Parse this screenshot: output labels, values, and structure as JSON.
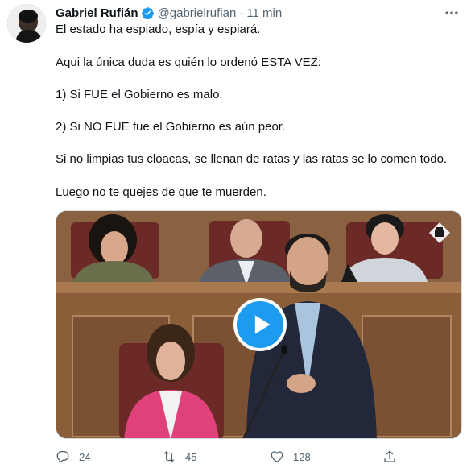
{
  "tweet": {
    "author_name": "Gabriel Rufián",
    "handle": "@gabrielrufian",
    "separator": "·",
    "time": "11 min",
    "verified": true,
    "paragraphs": [
      "El estado ha espiado, espía y espiará.",
      "Aqui la única duda es quién lo ordenó ESTA VEZ:",
      "1) Si FUE el Gobierno es malo.",
      "2) Si NO FUE fue el Gobierno es aún peor.",
      "Si no limpias tus cloacas, se llenan de ratas y las ratas se lo comen todo.",
      "Luego no te quejes de que te muerden."
    ],
    "media": {
      "type": "video",
      "play_icon": "play-icon",
      "watermark_icon": "congress-logo-icon"
    },
    "actions": {
      "reply_count": "24",
      "retweet_count": "45",
      "like_count": "128"
    }
  },
  "icons": {
    "more": "more-options-icon",
    "reply": "reply-icon",
    "retweet": "retweet-icon",
    "like": "heart-icon",
    "share": "share-icon",
    "verified": "verified-badge-icon"
  },
  "colors": {
    "accent": "#1d9bf0",
    "text_primary": "#0f1419",
    "text_secondary": "#536471",
    "border": "#cfd9de"
  }
}
